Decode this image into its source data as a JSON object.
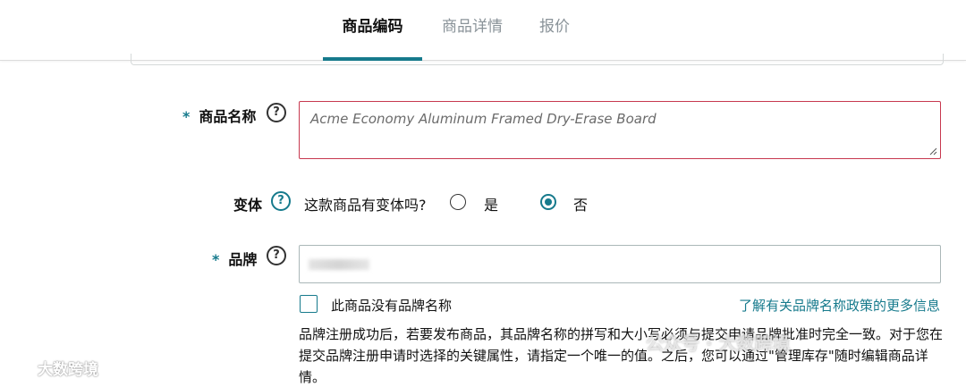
{
  "tabs": [
    {
      "label": "商品编码",
      "active": true
    },
    {
      "label": "商品详情",
      "active": false
    },
    {
      "label": "报价",
      "active": false
    }
  ],
  "form": {
    "required_mark": "*",
    "product_name": {
      "label": "商品名称",
      "value": "Acme Economy Aluminum Framed Dry-Erase Board"
    },
    "variation": {
      "label": "变体",
      "question": "这款商品有变体吗?",
      "options": [
        {
          "label": "是",
          "selected": false
        },
        {
          "label": "否",
          "selected": true
        }
      ]
    },
    "brand": {
      "label": "品牌",
      "value": "",
      "no_brand_checkbox_label": "此商品没有品牌名称",
      "no_brand_checked": false,
      "policy_link": "了解有关品牌名称政策的更多信息",
      "note": "品牌注册成功后，若要发布商品，其品牌名称的拼写和大小写必须与提交申请品牌批准时完全一致。对于您在提交品牌注册申请时选择的关键属性，请指定一个唯一的值。之后，您可以通过\"管理库存\"随时编辑商品详情。"
    },
    "help_icon": "question-circle-icon"
  },
  "watermarks": {
    "left": "大数跨境",
    "right": "公众号 · 大数跨境"
  },
  "colors": {
    "accent": "#167a8c",
    "error_border": "#c7384f"
  }
}
